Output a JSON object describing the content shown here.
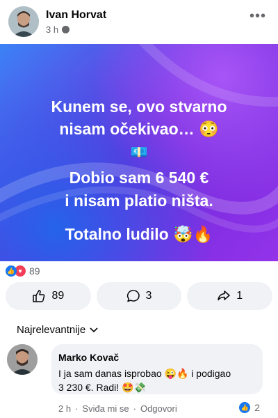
{
  "post": {
    "author": "Ivan Horvat",
    "time": "3 h",
    "hero": {
      "line1": "Kunem se, ovo stvarno",
      "line2": "nisam očekivao… 😳",
      "line3": "💶",
      "line4": "Dobio sam 6 540 €",
      "line5": "i nisam platio ništa.",
      "line6": "Totalno ludilo 🤯🔥"
    },
    "reaction_count": "89",
    "actions": {
      "like": "89",
      "comment": "3",
      "share": "1"
    }
  },
  "comments": {
    "sort_label": "Najrelevantnije",
    "items": [
      {
        "author": "Marko Kovač",
        "text_line1": "I ja sam danas isprobao 😜🔥 i podigao",
        "text_line2": "3 230 €. Radi! 🤩💸",
        "time": "2 h",
        "like_label": "Sviđa mi se",
        "reply_label": "Odgovori",
        "likes": "2"
      }
    ]
  },
  "colors": {
    "accent": "#1877f2",
    "love": "#f33e58",
    "hero_a": "#3b82f6",
    "hero_b": "#9333ea"
  }
}
